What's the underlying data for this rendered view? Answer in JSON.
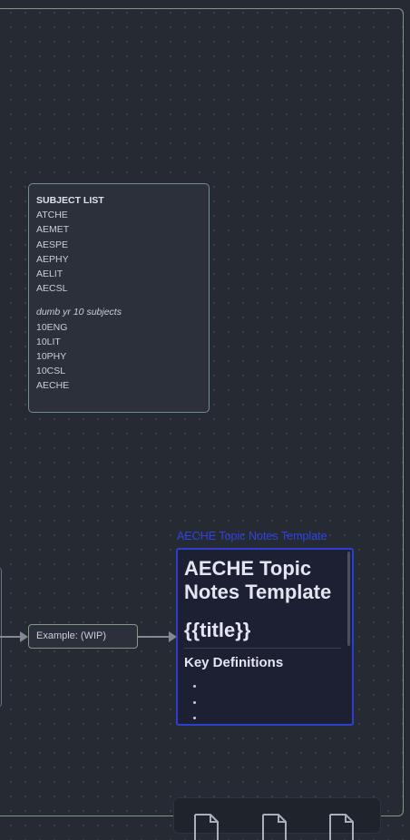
{
  "subject_list": {
    "heading": "SUBJECT LIST",
    "items": [
      "ATCHE",
      "AEMET",
      "AESPE",
      "AEPHY",
      "AELIT",
      "AECSL"
    ],
    "subheading": "dumb yr 10 subjects",
    "sub_items": [
      "10ENG",
      "10LIT",
      "10PHY",
      "10CSL",
      "AECHE"
    ]
  },
  "example_node": {
    "label": "Example: (WIP)"
  },
  "embed": {
    "link_title": "AECHE Topic Notes Template",
    "heading": "AECHE Topic Notes Template",
    "title_placeholder": "{{title}}",
    "section_heading": "Key Definitions",
    "bullet_count": 3
  },
  "toolbar": {
    "icons": [
      "file-icon",
      "file-icon",
      "file-icon"
    ]
  },
  "colors": {
    "canvas": "#262a33",
    "group_border": "#7f9a80",
    "card_border": "#6f8f8a",
    "embed_border": "#2e3fd0",
    "embed_link": "#2f43e6"
  }
}
